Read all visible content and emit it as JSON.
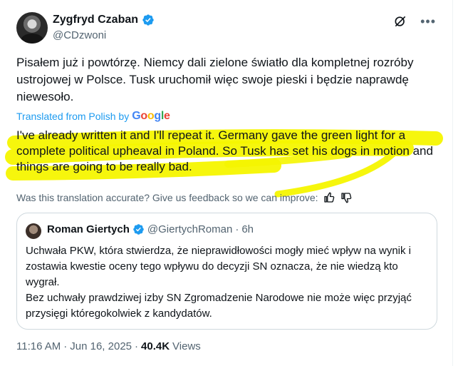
{
  "author": {
    "display_name": "Zygfryd Czaban",
    "handle": "@CDzwoni"
  },
  "post": {
    "text": "Pisałem już i powtórzę. Niemcy dali zielone światło dla kompletnej rozróby ustrojowej w Polsce. Tusk uruchomił więc swoje pieski i będzie naprawdę niewesoło.",
    "translated_label": "Translated from Polish by",
    "translation": "I've already written it and I'll repeat it. Germany gave the green light for a complete political upheaval in Poland. So Tusk has set his dogs in motion and things are going to be really bad.",
    "feedback_prompt": "Was this translation accurate? Give us feedback so we can improve:"
  },
  "quote": {
    "display_name": "Roman Giertych",
    "handle": "@GiertychRoman",
    "separator": "·",
    "time": "6h",
    "line1": "Uchwała PKW, która stwierdza, że nieprawidłowości mogły mieć wpływ na wynik i zostawia kwestie oceny tego wpływu do decyzji SN oznacza, że nie wiedzą kto wygrał.",
    "line2": "Bez uchwały prawdziwej izby SN Zgromadzenie Narodowe nie może więc przyjąć przysięgi któregokolwiek z kandydatów."
  },
  "footer": {
    "time": "11:16 AM",
    "separator1": "·",
    "date": "Jun 16, 2025",
    "separator2": "·",
    "views_count": "40.4K",
    "views_label": "Views"
  },
  "icons": {
    "verified": "verified-badge-icon",
    "grok": "grok-icon",
    "more": "more-icon",
    "thumbs_up": "thumbs-up-icon",
    "thumbs_down": "thumbs-down-icon"
  },
  "colors": {
    "accent": "#1d9bf0",
    "highlight": "#f5f500",
    "secondary_text": "#536471"
  }
}
